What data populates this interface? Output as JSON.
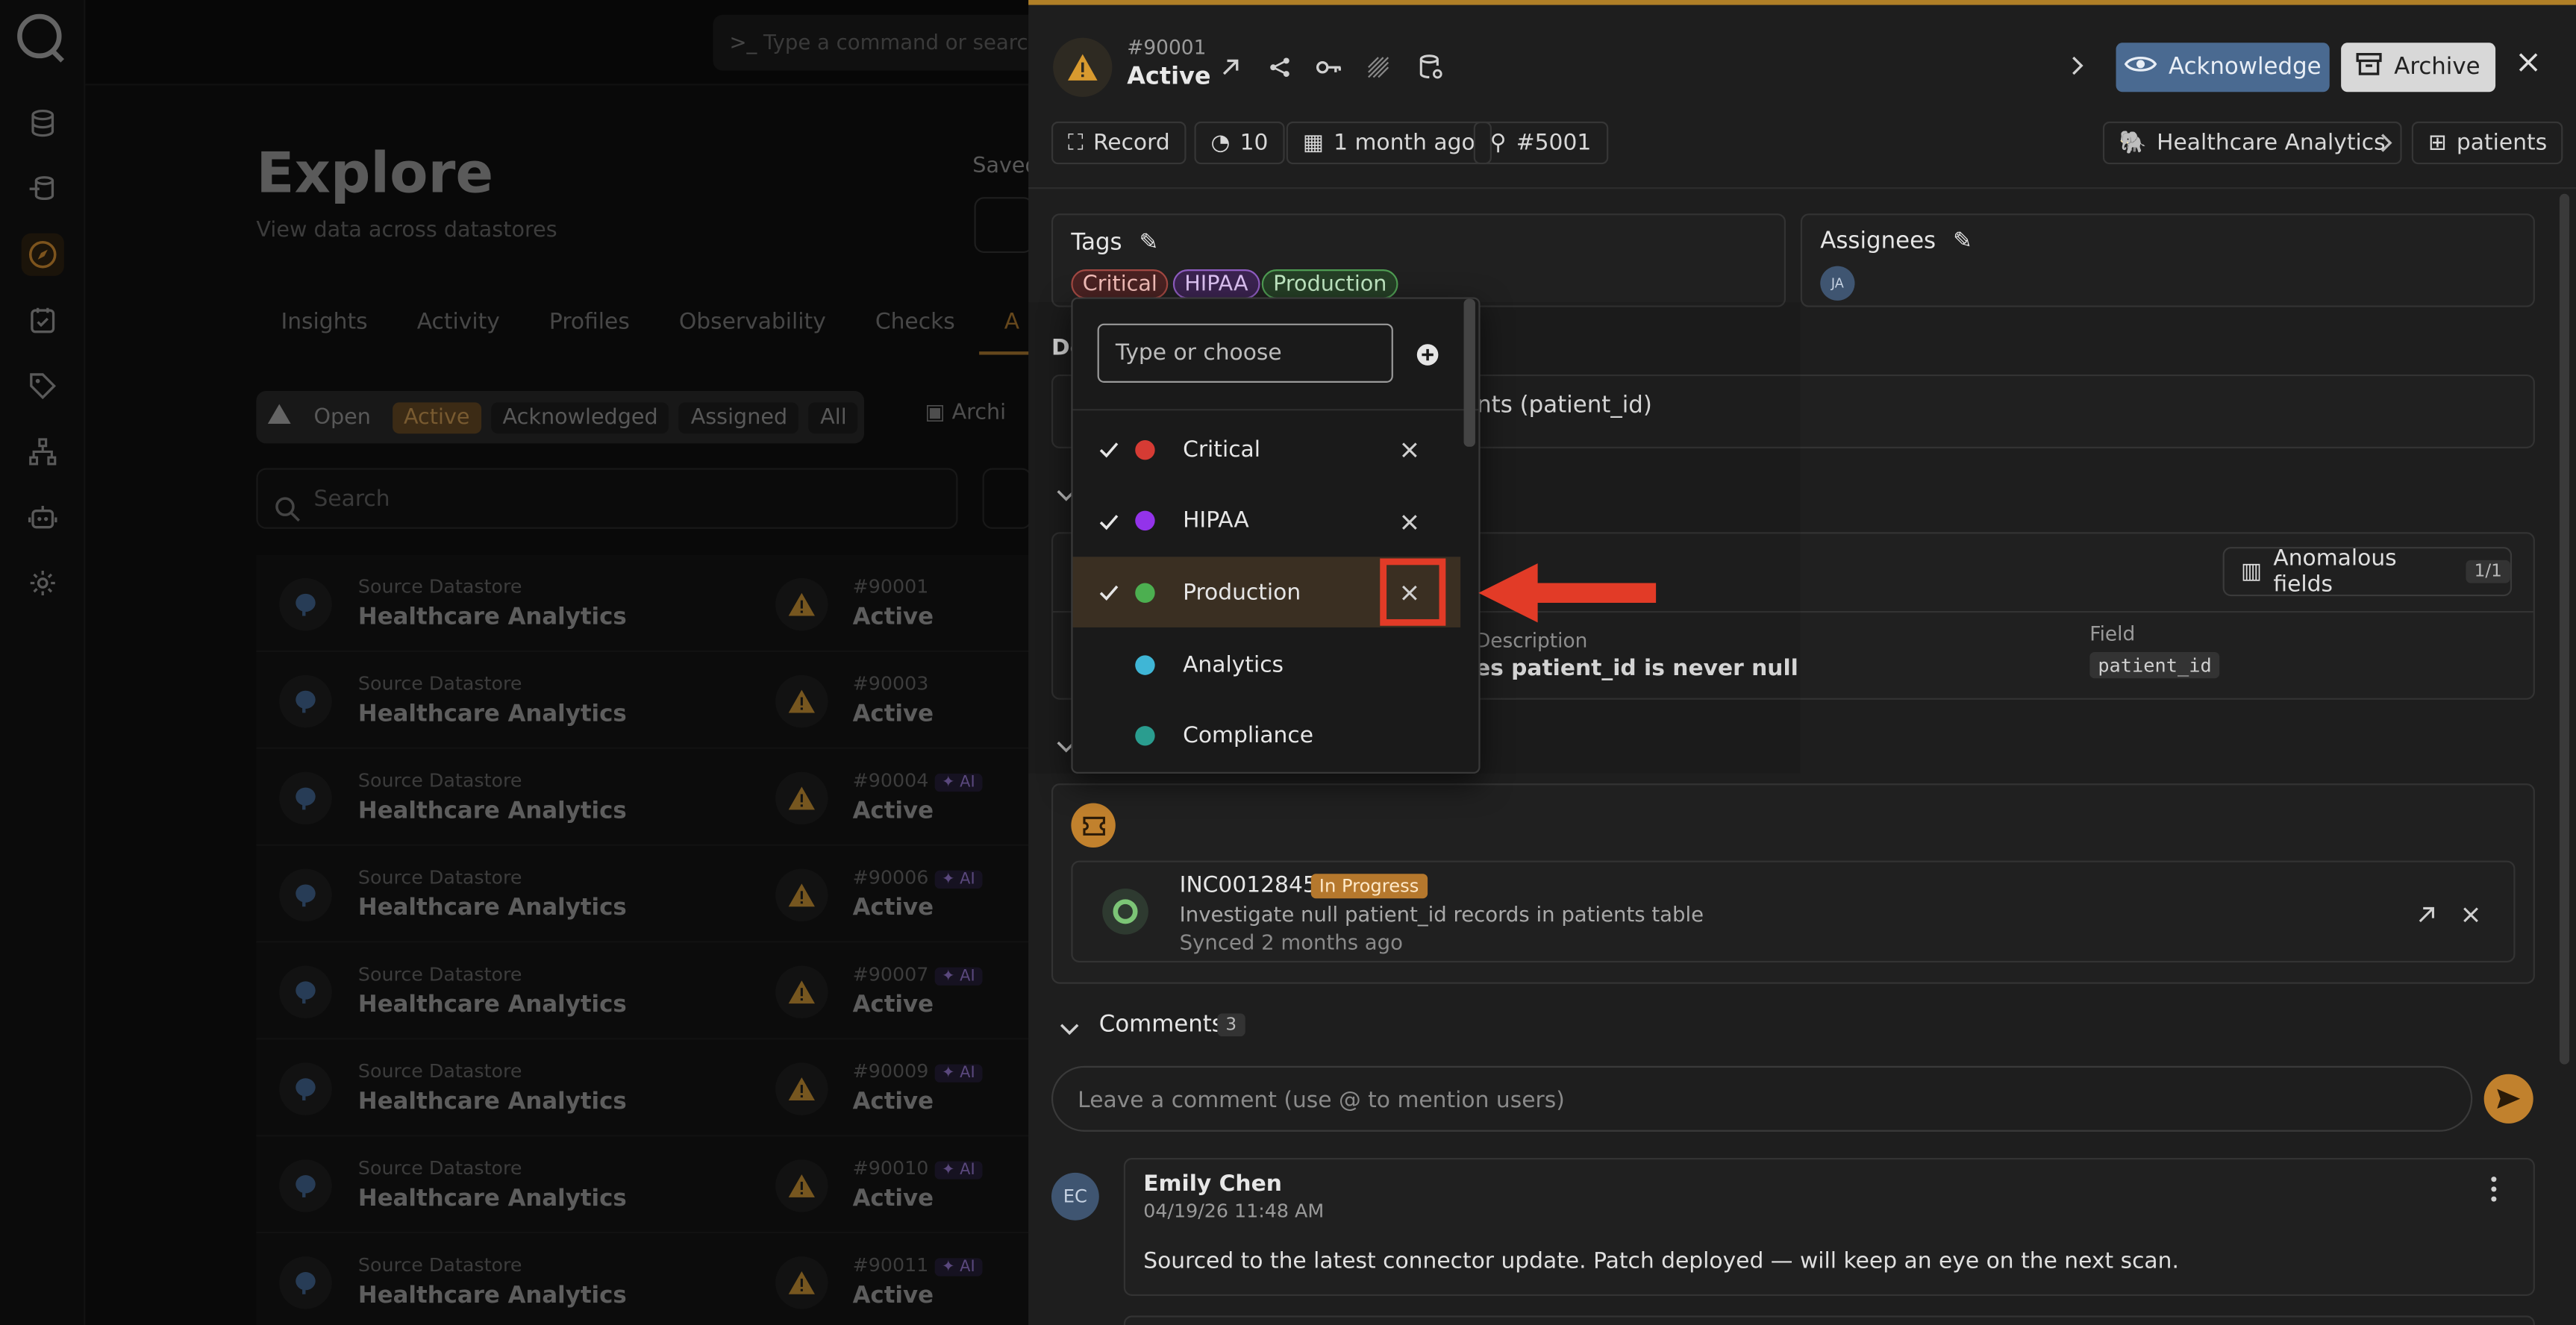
{
  "app": {
    "command_placeholder": "Type a command or search...",
    "page_title": "Explore",
    "page_subtitle": "View data across datastores",
    "saved_label": "Saved",
    "tabs": [
      {
        "label": "Insights"
      },
      {
        "label": "Activity"
      },
      {
        "label": "Profiles"
      },
      {
        "label": "Observability"
      },
      {
        "label": "Checks"
      },
      {
        "label": "A"
      }
    ],
    "status_filters": {
      "open": "Open",
      "active": "Active",
      "acknowledged": "Acknowledged",
      "assigned": "Assigned",
      "all": "All"
    },
    "archived_label": "Archi",
    "search_placeholder": "Search",
    "list": [
      {
        "source_label": "Source Datastore",
        "source_name": "Healthcare Analytics",
        "id": "#90001",
        "ai": "",
        "status": "Active"
      },
      {
        "source_label": "Source Datastore",
        "source_name": "Healthcare Analytics",
        "id": "#90003",
        "ai": "",
        "status": "Active"
      },
      {
        "source_label": "Source Datastore",
        "source_name": "Healthcare Analytics",
        "id": "#90004",
        "ai": "AI",
        "status": "Active"
      },
      {
        "source_label": "Source Datastore",
        "source_name": "Healthcare Analytics",
        "id": "#90006",
        "ai": "AI",
        "status": "Active"
      },
      {
        "source_label": "Source Datastore",
        "source_name": "Healthcare Analytics",
        "id": "#90007",
        "ai": "AI",
        "status": "Active"
      },
      {
        "source_label": "Source Datastore",
        "source_name": "Healthcare Analytics",
        "id": "#90009",
        "ai": "AI",
        "status": "Active"
      },
      {
        "source_label": "Source Datastore",
        "source_name": "Healthcare Analytics",
        "id": "#90010",
        "ai": "AI",
        "status": "Active"
      },
      {
        "source_label": "Source Datastore",
        "source_name": "Healthcare Analytics",
        "id": "#90011",
        "ai": "AI",
        "status": "Active"
      }
    ]
  },
  "panel": {
    "id": "#90001",
    "status": "Active",
    "acknowledge_label": "Acknowledge",
    "archive_label": "Archive",
    "meta": {
      "record": "Record",
      "score": "10",
      "time": "1 month ago",
      "check": "#5001"
    },
    "breadcrumb": {
      "datastore": "Healthcare Analytics",
      "table": "patients"
    },
    "tags_label": "Tags",
    "tags": [
      {
        "label": "Critical",
        "color": "#d9534f"
      },
      {
        "label": "HIPAA",
        "color": "#a15bcf"
      },
      {
        "label": "Production",
        "color": "#5cb85c"
      }
    ],
    "assignees_label": "Assignees",
    "assignee_initials": "JA",
    "description_label": "De",
    "description_text": "nts (patient_id)",
    "anomalous_fields_label": "Anomalous fields",
    "anomalous_fields_count": "1/1",
    "col_description": "Description",
    "col_description_value": "es patient_id is never null",
    "col_field": "Field",
    "col_field_value": "patient_id",
    "incident": {
      "id": "INC0012845",
      "state": "In Progress",
      "description": "Investigate null patient_id records in patients table",
      "synced": "Synced 2 months ago"
    },
    "comments_label": "Comments",
    "comments_count": "3",
    "comment_placeholder": "Leave a comment (use @ to mention users)",
    "comment": {
      "initials": "EC",
      "author": "Emily Chen",
      "date": "04/19/26 11:48 AM",
      "body": "Sourced to the latest connector update. Patch deployed — will keep an eye on the next scan."
    }
  },
  "dropdown": {
    "placeholder": "Type or choose",
    "options": [
      {
        "label": "Critical",
        "color": "#d63b34",
        "checked": true
      },
      {
        "label": "HIPAA",
        "color": "#9333ea",
        "checked": true
      },
      {
        "label": "Production",
        "color": "#4caf50",
        "checked": true,
        "highlighted": true
      },
      {
        "label": "Analytics",
        "color": "#3fb6d6",
        "checked": false
      },
      {
        "label": "Compliance",
        "color": "#2a9d8f",
        "checked": false
      }
    ]
  },
  "colors": {
    "accent": "#b07f27",
    "acknowledge_btn": "#4a6a91",
    "annotation_red": "#e23b27"
  }
}
